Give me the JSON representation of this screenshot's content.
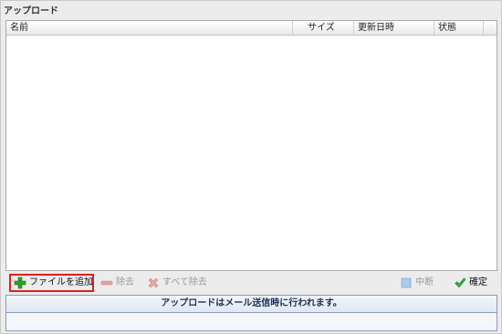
{
  "panel": {
    "title": "アップロード"
  },
  "grid": {
    "columns": [
      "名前",
      "サイズ",
      "更新日時",
      "状態"
    ],
    "rows": []
  },
  "toolbar": {
    "add_label": "ファイルを追加",
    "remove_label": "除去",
    "remove_all_label": "すべて除去",
    "stop_label": "中断",
    "confirm_label": "確定"
  },
  "info": {
    "message": "アップロードはメール送信時に行われます。"
  },
  "colors": {
    "add_highlight": "#e02020",
    "info_text": "#1c2f55"
  }
}
